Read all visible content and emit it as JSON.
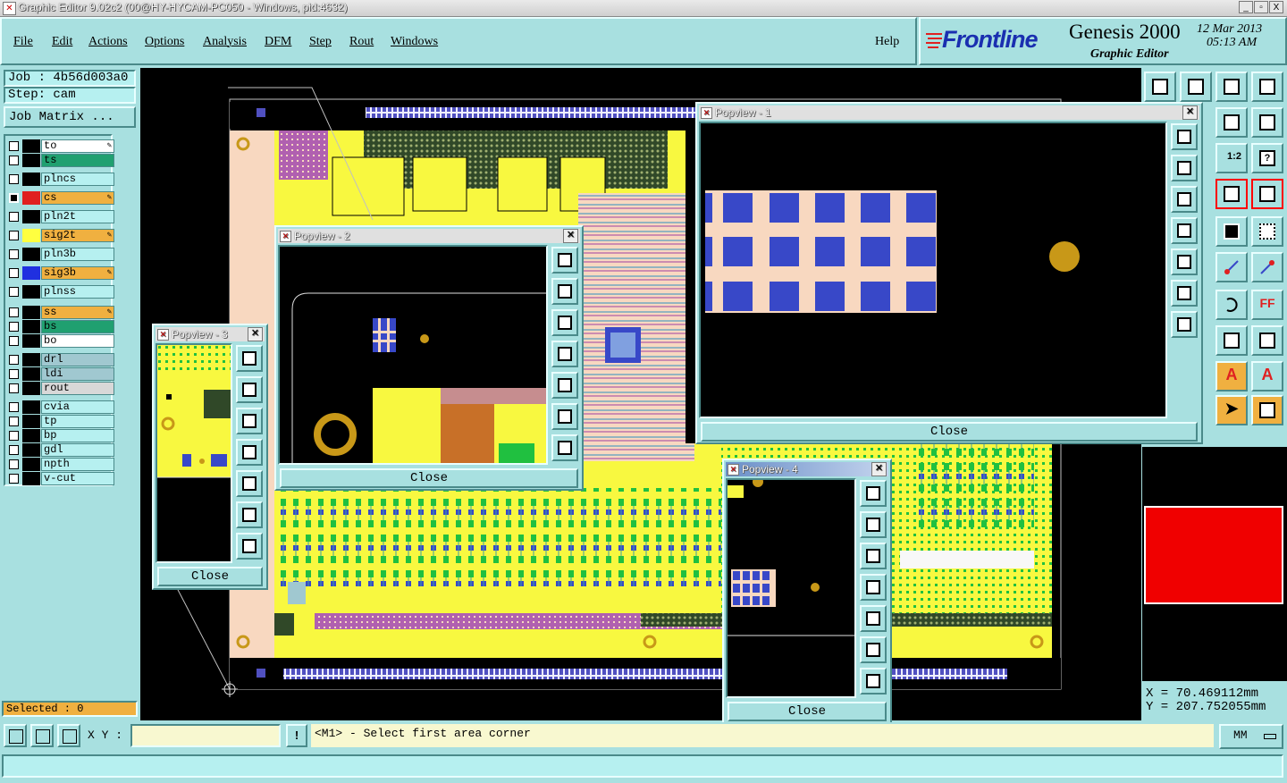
{
  "window": {
    "title": "Graphic Editor 9.02c2 (00@HY-HYCAM-PC050 - Windows, pid:4632)",
    "controls": [
      "_",
      "▫",
      "X"
    ]
  },
  "menu": {
    "items": [
      "File",
      "Edit",
      "Actions",
      "Options",
      "Analysis",
      "DFM",
      "Step",
      "Rout",
      "Windows"
    ],
    "help": "Help"
  },
  "brand": {
    "logo": "Frontline",
    "product": "Genesis 2000",
    "subtitle": "Graphic Editor",
    "date": "12 Mar 2013",
    "time": "05:13 AM"
  },
  "job": {
    "job_label": "Job : 4b56d003a0",
    "step_label": "Step: cam",
    "matrix_button": "Job Matrix ..."
  },
  "layers": [
    {
      "name": "to",
      "color": "#000000",
      "name_bg": "#ffffff",
      "checked": false,
      "pen": true
    },
    {
      "name": "ts",
      "color": "#000000",
      "name_bg": "#20a070",
      "checked": false,
      "pen": false
    },
    {
      "name": "plncs",
      "color": "#000000",
      "name_bg": "#b6f0f0",
      "checked": false,
      "pen": false
    },
    {
      "name": "cs",
      "color": "#e02020",
      "name_bg": "#f0b040",
      "checked": true,
      "pen": true
    },
    {
      "name": "pln2t",
      "color": "#000000",
      "name_bg": "#b6f0f0",
      "checked": false,
      "pen": false
    },
    {
      "name": "sig2t",
      "color": "#ffff40",
      "name_bg": "#f0b040",
      "checked": false,
      "pen": true
    },
    {
      "name": "pln3b",
      "color": "#000000",
      "name_bg": "#b6f0f0",
      "checked": false,
      "pen": false
    },
    {
      "name": "sig3b",
      "color": "#2030e0",
      "name_bg": "#f0b040",
      "checked": false,
      "pen": true
    },
    {
      "name": "plnss",
      "color": "#000000",
      "name_bg": "#b6f0f0",
      "checked": false,
      "pen": false
    },
    {
      "name": "ss",
      "color": "#000000",
      "name_bg": "#f0b040",
      "checked": false,
      "pen": true
    },
    {
      "name": "bs",
      "color": "#000000",
      "name_bg": "#20a070",
      "checked": false,
      "pen": false
    },
    {
      "name": "bo",
      "color": "#000000",
      "name_bg": "#ffffff",
      "checked": false,
      "pen": false
    },
    {
      "name": "drl",
      "color": "#000000",
      "name_bg": "#a0c8d0",
      "checked": false,
      "pen": false
    },
    {
      "name": "ldi",
      "color": "#000000",
      "name_bg": "#a0c8d0",
      "checked": false,
      "pen": false
    },
    {
      "name": "rout",
      "color": "#000000",
      "name_bg": "#d8d8d8",
      "checked": false,
      "pen": false
    },
    {
      "name": "cvia",
      "color": "#000000",
      "name_bg": "#b6f0f0",
      "checked": false,
      "pen": false
    },
    {
      "name": "tp",
      "color": "#000000",
      "name_bg": "#b6f0f0",
      "checked": false,
      "pen": false
    },
    {
      "name": "bp",
      "color": "#000000",
      "name_bg": "#b6f0f0",
      "checked": false,
      "pen": false
    },
    {
      "name": "gdl",
      "color": "#000000",
      "name_bg": "#b6f0f0",
      "checked": false,
      "pen": false
    },
    {
      "name": "npth",
      "color": "#000000",
      "name_bg": "#b6f0f0",
      "checked": false,
      "pen": false
    },
    {
      "name": "v-cut",
      "color": "#000000",
      "name_bg": "#b6f0f0",
      "checked": false,
      "pen": false
    }
  ],
  "selected": "Selected : 0",
  "popviews": [
    {
      "title": "Popview - 1",
      "close": "Close"
    },
    {
      "title": "Popview - 2",
      "close": "Close"
    },
    {
      "title": "Popview - 3",
      "close": "Close"
    },
    {
      "title": "Popview - 4",
      "close": "Close"
    }
  ],
  "toolbar_right": {
    "icons": [
      "top-view-icon",
      "bottom-view-icon",
      "home-icon",
      "split-icon",
      "rotate-left-icon",
      "snake-icon",
      "ratio-icon",
      "help-icon",
      "measure-icon",
      "ruler-icon",
      "pad-icon",
      "line-icon",
      "arc-icon",
      "font-icon",
      "cross-icon",
      "text-a-icon",
      "arrow-icon",
      "route-icon"
    ],
    "labels": {
      "ratio": "1:2",
      "font": "FF"
    },
    "coords": {
      "x": "X =  70.469112mm",
      "y": "Y = 207.752055mm"
    }
  },
  "statusbar": {
    "xy_label": "X Y :",
    "xy_value": "",
    "message": "<M1> - Select first area corner",
    "units": "MM",
    "excl": "!"
  },
  "colors": {
    "panel": "#a8e0e0",
    "board_yellow": "#f8f840",
    "board_peach": "#f8d8c0",
    "pad_blue": "#3848c8",
    "copper_gold": "#c89818",
    "highlight_red": "#f00000"
  }
}
